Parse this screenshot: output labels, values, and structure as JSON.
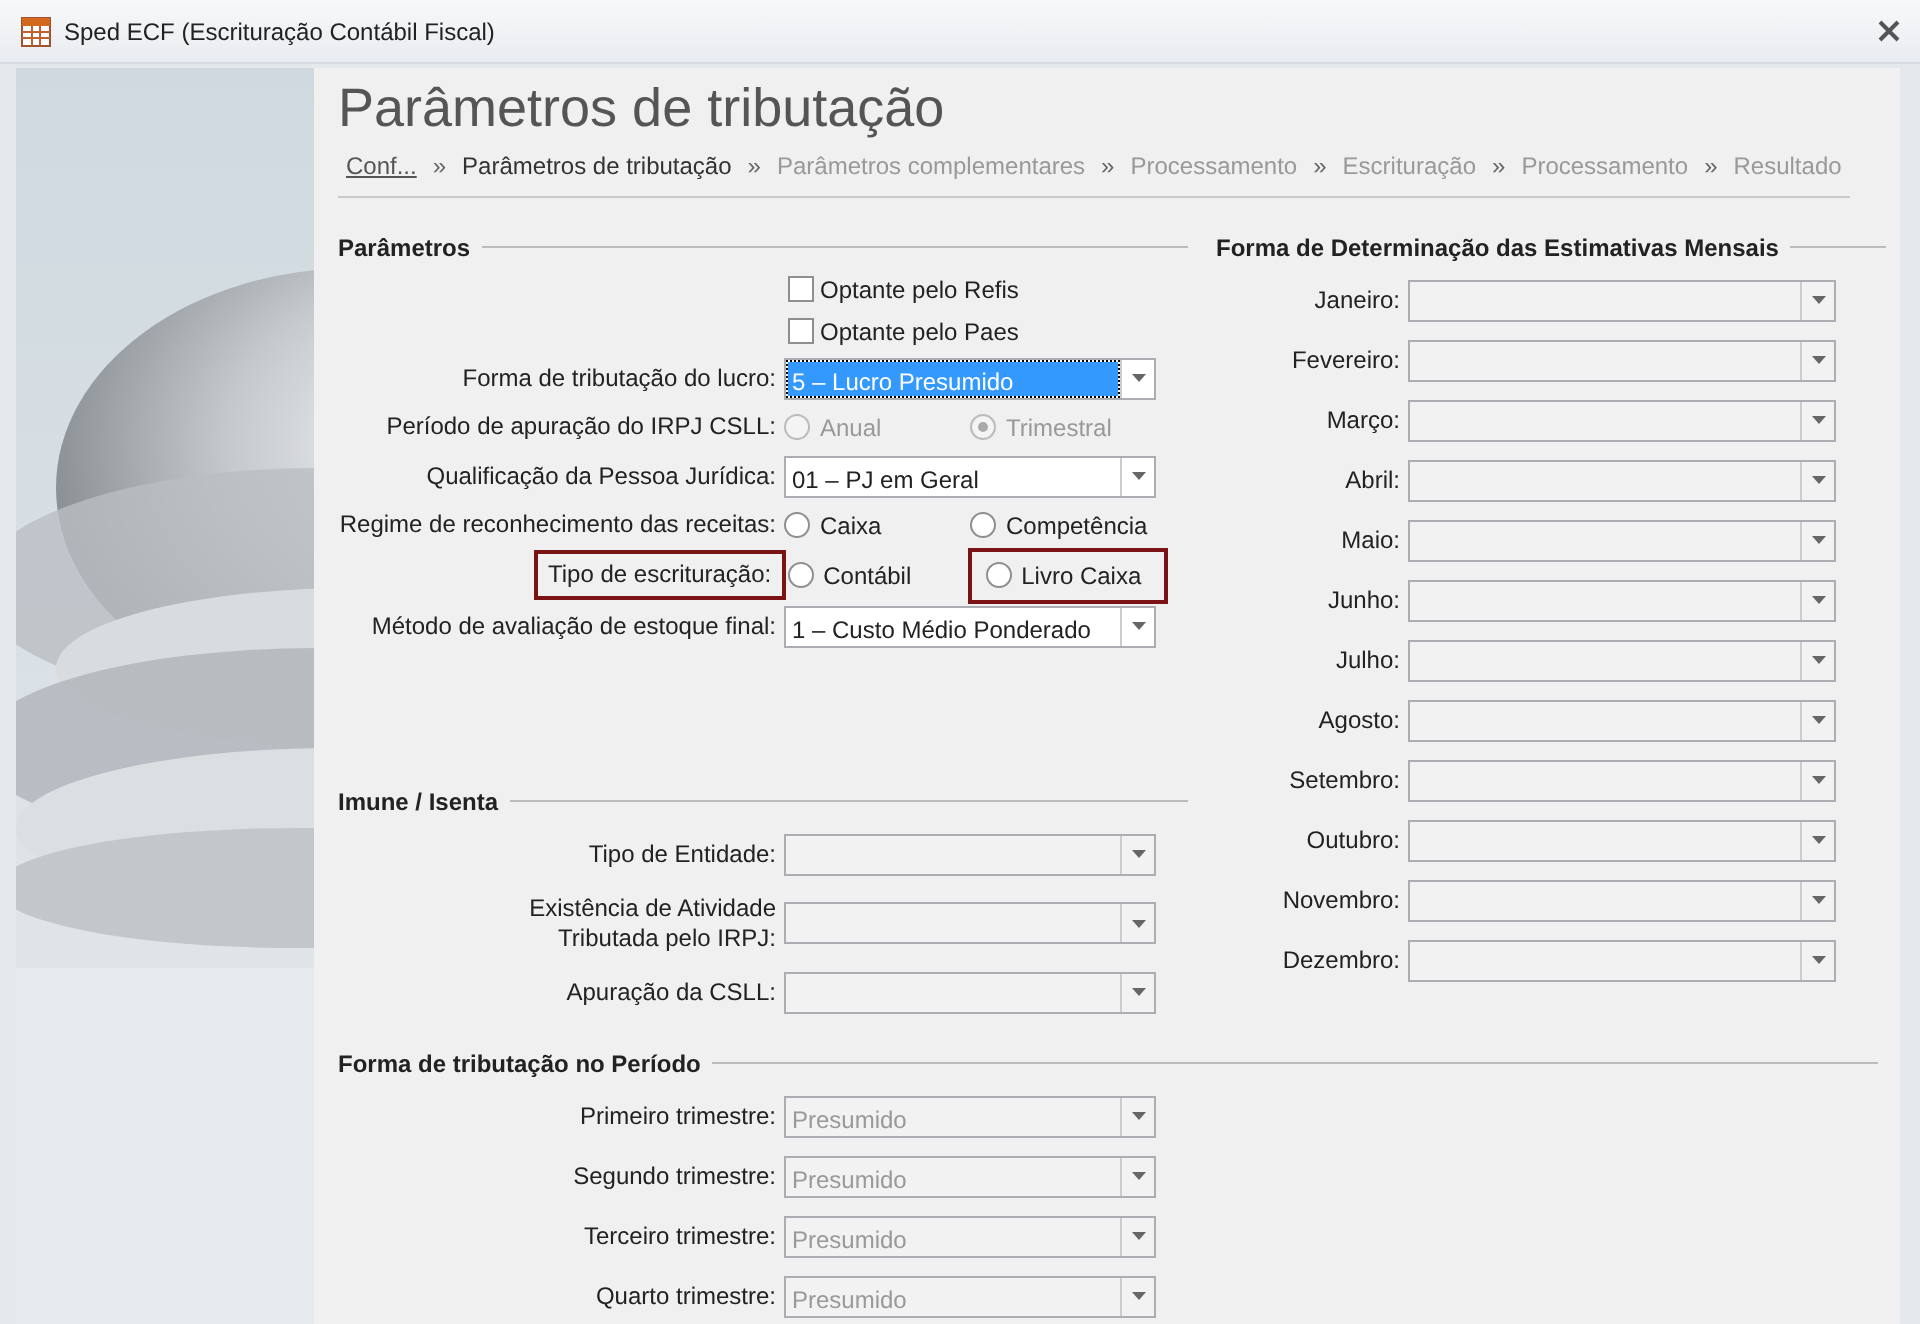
{
  "window": {
    "title": "Sped ECF (Escrituração Contábil Fiscal)"
  },
  "page_title": "Parâmetros de tributação",
  "breadcrumb": [
    {
      "label": "Conf...",
      "kind": "done"
    },
    {
      "label": "Parâmetros de tributação",
      "kind": "current"
    },
    {
      "label": "Parâmetros complementares",
      "kind": "pending"
    },
    {
      "label": "Processamento",
      "kind": "pending"
    },
    {
      "label": "Escrituração",
      "kind": "pending"
    },
    {
      "label": "Processamento",
      "kind": "pending"
    },
    {
      "label": "Resultado",
      "kind": "pending"
    }
  ],
  "breadcrumb_separator": "»",
  "parametros": {
    "title": "Parâmetros",
    "rows": [
      {
        "kind": "checkbox",
        "label": "Optante pelo Refis",
        "checked": false
      },
      {
        "kind": "checkbox",
        "label": "Optante pelo Paes",
        "checked": false
      },
      {
        "kind": "select",
        "label": "Forma de tributação do lucro:",
        "value": "5 – Lucro Presumido",
        "focused": true,
        "disabled": false
      },
      {
        "kind": "radio",
        "label": "Período de apuração do IRPJ CSLL:",
        "options": [
          {
            "label": "Anual",
            "selected": false,
            "disabled": true
          },
          {
            "label": "Trimestral",
            "selected": true,
            "disabled": true
          }
        ]
      },
      {
        "kind": "select",
        "label": "Qualificação da Pessoa Jurídica:",
        "value": "01 – PJ em Geral",
        "focused": false,
        "disabled": false
      },
      {
        "kind": "radio",
        "label": "Regime de reconhecimento das receitas:",
        "options": [
          {
            "label": "Caixa",
            "selected": false,
            "disabled": false
          },
          {
            "label": "Competência",
            "selected": false,
            "disabled": false
          }
        ]
      },
      {
        "kind": "radio",
        "label": "Tipo de escrituração:",
        "label_highlighted": true,
        "options": [
          {
            "label": "Contábil",
            "selected": false,
            "disabled": false
          },
          {
            "label": "Livro Caixa",
            "selected": false,
            "disabled": false,
            "highlighted": true
          }
        ]
      },
      {
        "kind": "select",
        "label": "Método de avaliação de estoque final:",
        "value": "1 – Custo Médio Ponderado",
        "focused": false,
        "disabled": false
      }
    ]
  },
  "imune": {
    "title": "Imune / Isenta",
    "rows": [
      {
        "kind": "select",
        "label": "Tipo de Entidade:",
        "focused": false,
        "disabled": true
      },
      {
        "kind": "select",
        "label": "Existência de Atividade\nTributada pelo IRPJ:",
        "focused": false,
        "disabled": true
      },
      {
        "kind": "select",
        "label": "Apuração da CSLL:",
        "focused": false,
        "disabled": true
      }
    ]
  },
  "periodo": {
    "title": "Forma de tributação no Período",
    "rows": [
      {
        "kind": "select",
        "label": "Primeiro trimestre:",
        "value": "Presumido",
        "focused": false,
        "disabled": true
      },
      {
        "kind": "select",
        "label": "Segundo trimestre:",
        "value": "Presumido",
        "focused": false,
        "disabled": true
      },
      {
        "kind": "select",
        "label": "Terceiro trimestre:",
        "value": "Presumido",
        "focused": false,
        "disabled": true
      },
      {
        "kind": "select",
        "label": "Quarto trimestre:",
        "value": "Presumido",
        "focused": false,
        "disabled": true
      }
    ]
  },
  "estimativas": {
    "title": "Forma de Determinação das Estimativas Mensais",
    "rows": [
      {
        "kind": "select",
        "label": "Janeiro:",
        "focused": false,
        "disabled": true
      },
      {
        "kind": "select",
        "label": "Fevereiro:",
        "focused": false,
        "disabled": true
      },
      {
        "kind": "select",
        "label": "Março:",
        "focused": false,
        "disabled": true
      },
      {
        "kind": "select",
        "label": "Abril:",
        "focused": false,
        "disabled": true
      },
      {
        "kind": "select",
        "label": "Maio:",
        "focused": false,
        "disabled": true
      },
      {
        "kind": "select",
        "label": "Junho:",
        "focused": false,
        "disabled": true
      },
      {
        "kind": "select",
        "label": "Julho:",
        "focused": false,
        "disabled": true
      },
      {
        "kind": "select",
        "label": "Agosto:",
        "focused": false,
        "disabled": true
      },
      {
        "kind": "select",
        "label": "Setembro:",
        "focused": false,
        "disabled": true
      },
      {
        "kind": "select",
        "label": "Outubro:",
        "focused": false,
        "disabled": true
      },
      {
        "kind": "select",
        "label": "Novembro:",
        "focused": false,
        "disabled": true
      },
      {
        "kind": "select",
        "label": "Dezembro:",
        "focused": false,
        "disabled": true
      }
    ]
  }
}
